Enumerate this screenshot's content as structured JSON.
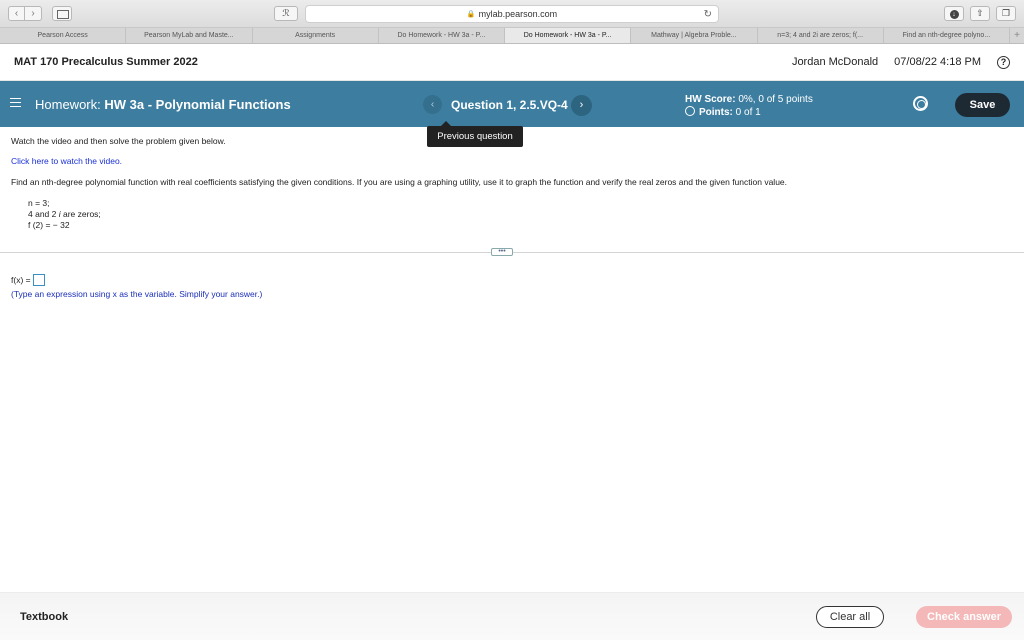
{
  "browser": {
    "url": "mylab.pearson.com",
    "ext_label": "ℛ",
    "tabs": [
      {
        "label": "Pearson Access"
      },
      {
        "label": "Pearson MyLab and Maste..."
      },
      {
        "label": "Assignments"
      },
      {
        "label": "Do Homework - HW 3a - P..."
      },
      {
        "label": "Do Homework - HW 3a - P..."
      },
      {
        "label": "Mathway | Algebra Proble..."
      },
      {
        "label": "n=3; 4 and 2i are zeros; f(..."
      },
      {
        "label": "Find an nth-degree polyno..."
      }
    ],
    "active_tab": 4
  },
  "course": {
    "title": "MAT 170 Precalculus Summer 2022",
    "user": "Jordan McDonald",
    "datetime": "07/08/22 4:18 PM",
    "help": "?"
  },
  "hwbar": {
    "prefix": "Homework:",
    "title": "HW 3a - Polynomial Functions",
    "question": "Question 1, 2.5.VQ-4",
    "prev": "‹",
    "next": "›",
    "score_label": "HW Score:",
    "score_value": "0%, 0 of 5 points",
    "points_label": "Points:",
    "points_value": "0 of 1",
    "save": "Save"
  },
  "tooltip": "Previous question",
  "content": {
    "instruction": "Watch the video and then solve the problem given below.",
    "video_link": "Click here to watch the video.",
    "prompt": "Find an nth-degree polynomial function with real coefficients satisfying the given conditions. If you are using a graphing utility, use it to graph the function and verify the real zeros and the given function value.",
    "cond_n": "n = 3;",
    "cond_zeros_pre": "4 and 2",
    "cond_zeros_i": "i",
    "cond_zeros_post": " are zeros;",
    "cond_f": "f (2) = − 32",
    "expand": "•••",
    "answer_label": "f(x) =",
    "hint": "(Type an expression using x as the variable. Simplify your answer.)"
  },
  "footer": {
    "textbook": "Textbook",
    "clear": "Clear all",
    "check": "Check answer"
  },
  "colors": {
    "bar": "#3d7ea0",
    "link": "#1a2fd6",
    "check_disabled": "#f4b8b8"
  }
}
